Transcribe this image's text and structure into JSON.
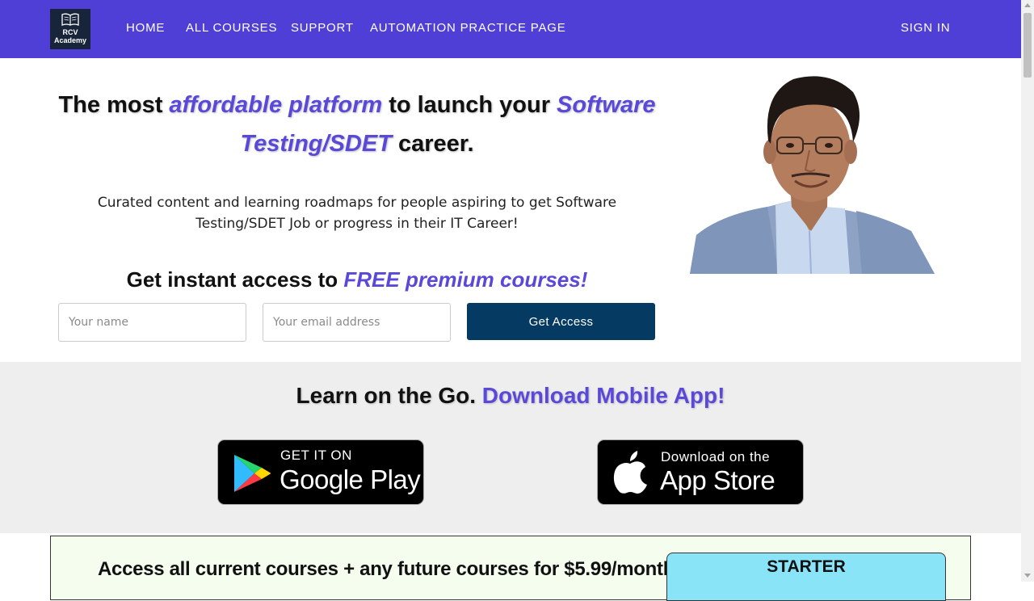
{
  "nav": {
    "logo_line1": "RCV",
    "logo_line2": "Academy",
    "items": [
      {
        "label": "HOME"
      },
      {
        "label": "ALL COURSES"
      },
      {
        "label": "SUPPORT"
      },
      {
        "label": "AUTOMATION PRACTICE PAGE"
      }
    ],
    "sign_in": "SIGN IN"
  },
  "hero": {
    "title_part1": "The most ",
    "title_accent1": "affordable platform",
    "title_part2": " to launch your ",
    "title_accent2": "Software Testing/SDET",
    "title_part3": " career.",
    "subtitle_line1": "Curated content and learning roadmaps for people aspiring to get Software",
    "subtitle_line2": "Testing/SDET Job or progress in their IT Career!",
    "cta_part1": "Get instant access to ",
    "cta_accent": "FREE premium courses!",
    "name_placeholder": "Your name",
    "email_placeholder": "Your email address",
    "button_label": "Get Access"
  },
  "app_section": {
    "title_part1": "Learn on the Go. ",
    "title_accent": "Download Mobile App!",
    "google_small": "GET IT ON",
    "google_big": "Google Play",
    "apple_small": "Download on the",
    "apple_big": "App Store"
  },
  "pricing": {
    "text": "Access all current courses + any future courses for $5.99/month",
    "plan_name": "STARTER"
  },
  "colors": {
    "nav_bg": "#4f3fd6",
    "accent": "#5a49d8",
    "button_bg": "#053b63",
    "app_section_bg": "#eeeeee",
    "pricing_bg": "#f4fdee",
    "plan_bg": "#8ae4f8"
  },
  "icons": [
    "book-icon",
    "google-play-icon",
    "apple-icon"
  ]
}
